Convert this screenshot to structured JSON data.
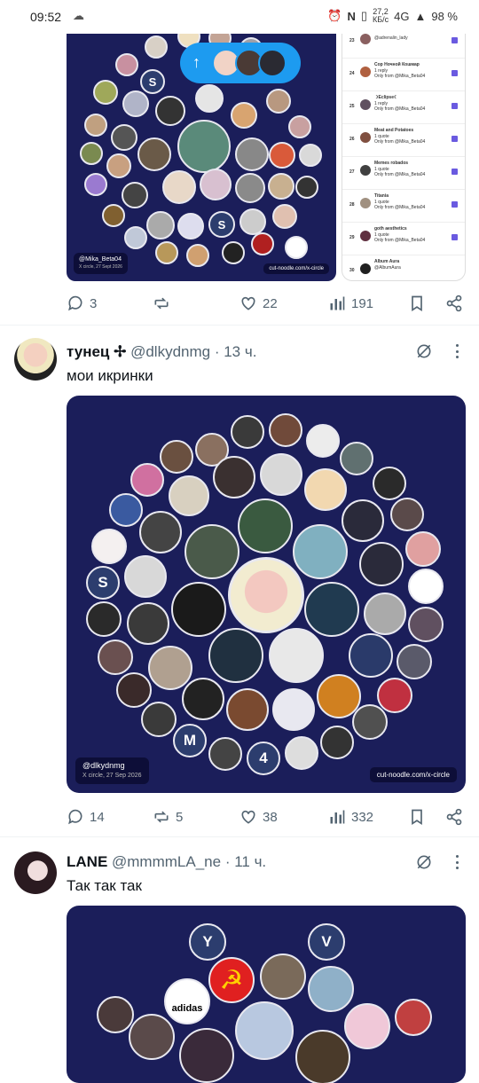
{
  "status_bar": {
    "time": "09:52",
    "speed": "27,2\nКБ/с",
    "network": "4G",
    "battery": "98 %"
  },
  "scroll_top": {
    "label": "↑"
  },
  "tweets": [
    {
      "id": "t0",
      "media": {
        "tag_handle": "@Mika_Beta04",
        "tag_sub": "X circle, 27 Sept 2026",
        "tag_site": "cut-noodle.com/x-circle",
        "letters": [
          "S",
          "S"
        ],
        "phone_rows": [
          {
            "num": "23",
            "name": "adrenalin_lady",
            "sub": "@adrenalin_lady"
          },
          {
            "num": "24",
            "name": "Cop Ночной Кошмар",
            "sub": "1 reply\nOnly from @Mika_Beta04"
          },
          {
            "num": "25",
            "name": "☽Eclipse☾",
            "sub": "1 reply\nOnly from @Mika_Beta04"
          },
          {
            "num": "26",
            "name": "Meat and Potatoes",
            "sub": "1 quote\nOnly from @Mika_Beta04"
          },
          {
            "num": "27",
            "name": "Memes robados",
            "sub": "1 quote\nOnly from @Mika_Beta04"
          },
          {
            "num": "28",
            "name": "Titania",
            "sub": "1 quote\nOnly from @Mika_Beta04"
          },
          {
            "num": "29",
            "name": "goth aesthetics",
            "sub": "1 quote\nOnly from @Mika_Beta04"
          },
          {
            "num": "30",
            "name": "Album Aura",
            "sub": "@AlbumAura"
          }
        ]
      },
      "actions": {
        "replies": "3",
        "reposts": "",
        "likes": "22",
        "views": "191"
      }
    },
    {
      "id": "t1",
      "name": "тунец ✢",
      "handle": "@dlkydnmg",
      "time": "· 13 ч.",
      "text": "мои икринки",
      "media": {
        "tag_handle": "@dlkydnmg",
        "tag_sub": "X circle, 27 Sep 2026",
        "tag_site": "cut-noodle.com/x-circle",
        "letters": [
          "S",
          "M",
          "4"
        ]
      },
      "actions": {
        "replies": "14",
        "reposts": "5",
        "likes": "38",
        "views": "332"
      }
    },
    {
      "id": "t2",
      "name": "LANE",
      "handle": "@mmmmLA_ne",
      "time": "· 11 ч.",
      "text": "Так так так",
      "media": {
        "letters": [
          "Y",
          "V"
        ],
        "brand": "adidas"
      }
    }
  ],
  "colors": {
    "accent": "#1d9bf0",
    "media_bg": "#1d1f5c",
    "muted": "#536471"
  }
}
